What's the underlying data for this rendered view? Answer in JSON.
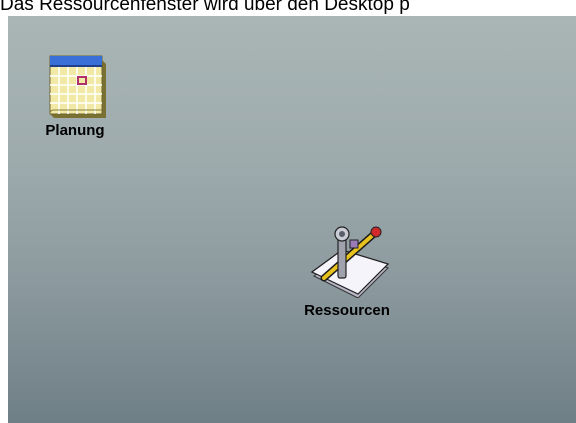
{
  "caption": {
    "text": "Das Ressourcenfenster wird über den Desktop p"
  },
  "desktop": {
    "icons": [
      {
        "label": "Planung",
        "icon": "calendar-icon"
      },
      {
        "label": "Ressourcen",
        "icon": "resources-tools-icon"
      }
    ]
  },
  "colors": {
    "desktop_top": "#aab6b5",
    "desktop_bottom": "#6f7f86",
    "calendar_header": "#3a6fd8",
    "calendar_body": "#f2e9a6",
    "calendar_marker": "#b0306a"
  }
}
